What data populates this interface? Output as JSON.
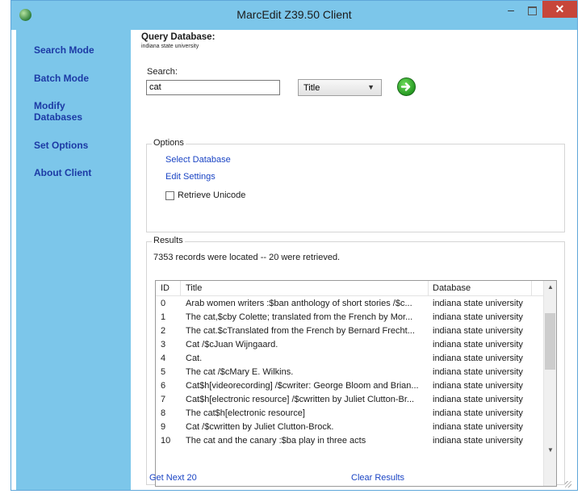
{
  "window": {
    "title": "MarcEdit Z39.50 Client",
    "minimize": "–",
    "close": "✕"
  },
  "sidebar": {
    "items": [
      {
        "label": "Search Mode"
      },
      {
        "label": "Batch Mode"
      },
      {
        "label": "Modify Databases"
      },
      {
        "label": "Set Options"
      },
      {
        "label": "About Client"
      }
    ]
  },
  "query": {
    "title": "Query Database:",
    "database": "indiana state university"
  },
  "search": {
    "label": "Search:",
    "value": "cat",
    "field": "Title"
  },
  "options": {
    "legend": "Options",
    "select_database": "Select Database",
    "edit_settings": "Edit Settings",
    "retrieve_unicode": "Retrieve Unicode",
    "retrieve_unicode_checked": false
  },
  "results": {
    "legend": "Results",
    "summary": "7353 records were located -- 20 were retrieved.",
    "columns": {
      "id": "ID",
      "title": "Title",
      "database": "Database"
    },
    "rows": [
      {
        "id": "0",
        "title": "Arab women writers :$ban anthology of short stories /$c...",
        "database": "indiana state university"
      },
      {
        "id": "1",
        "title": "The cat,$cby Colette; translated from the French by Mor...",
        "database": "indiana state university"
      },
      {
        "id": "2",
        "title": "The cat.$cTranslated from the French by Bernard Frecht...",
        "database": "indiana state university"
      },
      {
        "id": "3",
        "title": "Cat /$cJuan Wijngaard.",
        "database": "indiana state university"
      },
      {
        "id": "4",
        "title": "Cat.",
        "database": "indiana state university"
      },
      {
        "id": "5",
        "title": "The cat /$cMary E. Wilkins.",
        "database": "indiana state university"
      },
      {
        "id": "6",
        "title": "Cat$h[videorecording] /$cwriter: George Bloom and Brian...",
        "database": "indiana state university"
      },
      {
        "id": "7",
        "title": "Cat$h[electronic resource] /$cwritten by Juliet Clutton-Br...",
        "database": "indiana state university"
      },
      {
        "id": "8",
        "title": "The cat$h[electronic resource]",
        "database": "indiana state university"
      },
      {
        "id": "9",
        "title": "Cat /$cwritten by Juliet Clutton-Brock.",
        "database": "indiana state university"
      },
      {
        "id": "10",
        "title": "The cat and the canary :$ba play in three acts",
        "database": "indiana state university"
      }
    ]
  },
  "footer": {
    "get_next": "Get Next 20",
    "clear_results": "Clear Results"
  }
}
